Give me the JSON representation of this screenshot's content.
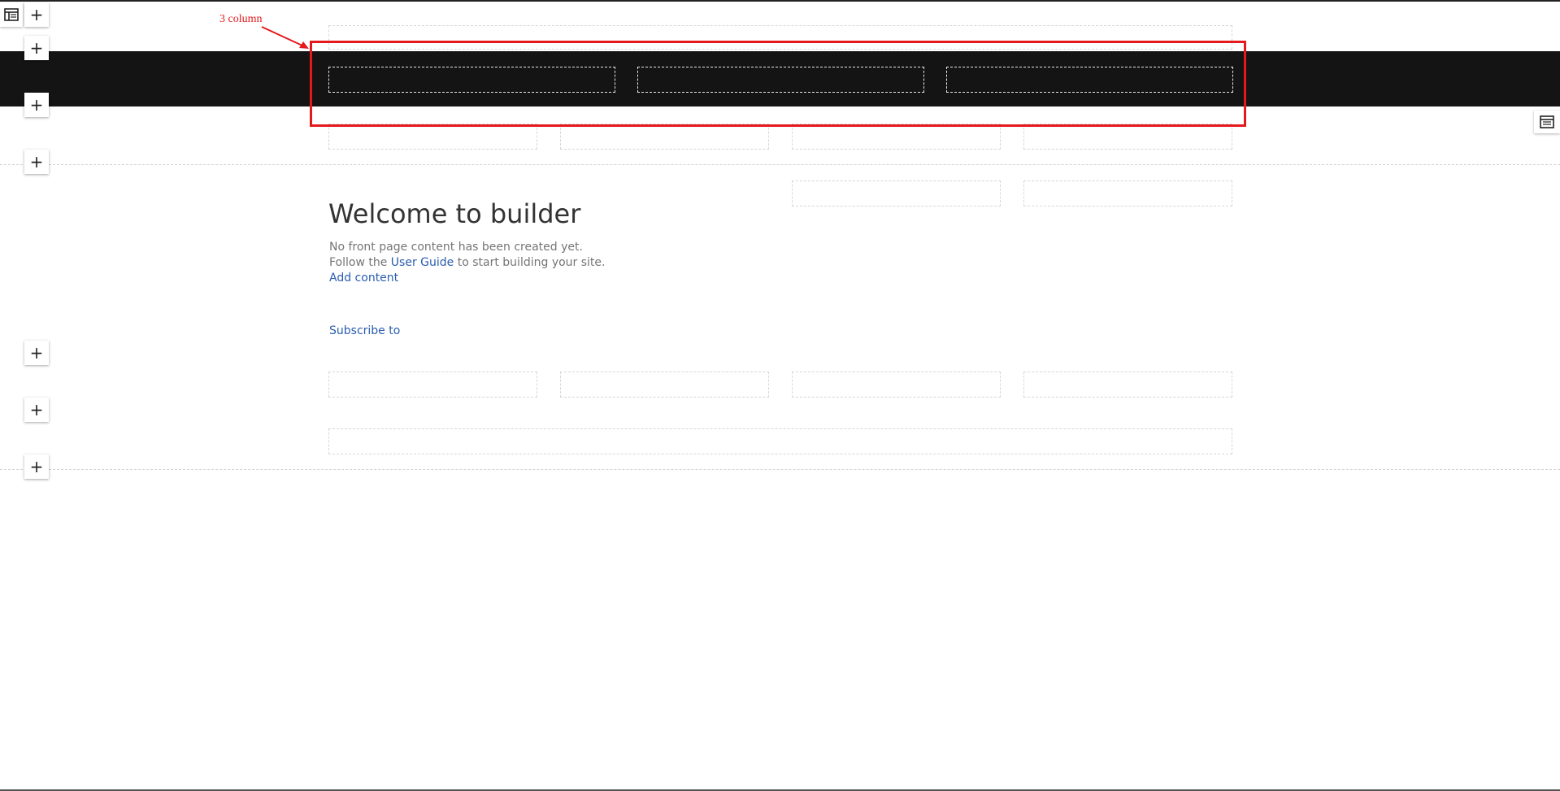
{
  "annotation": {
    "label": "3 column",
    "color": "#e5191b"
  },
  "main": {
    "title": "Welcome to builder",
    "intro_line1": "No front page content has been created yet.",
    "intro_line2_prefix": "Follow the ",
    "user_guide_link": "User Guide",
    "intro_line2_suffix": " to start building your site.",
    "add_content_link": "Add content",
    "subscribe_link": "Subscribe to"
  },
  "toolbar": {
    "add_section_symbol": "+",
    "layout_icon": "layout-icon",
    "side_panel_icon": "panel-icon"
  },
  "colors": {
    "dark_band": "#141414",
    "link": "#2a5db0",
    "heading": "#333333",
    "body_text": "#757575"
  }
}
